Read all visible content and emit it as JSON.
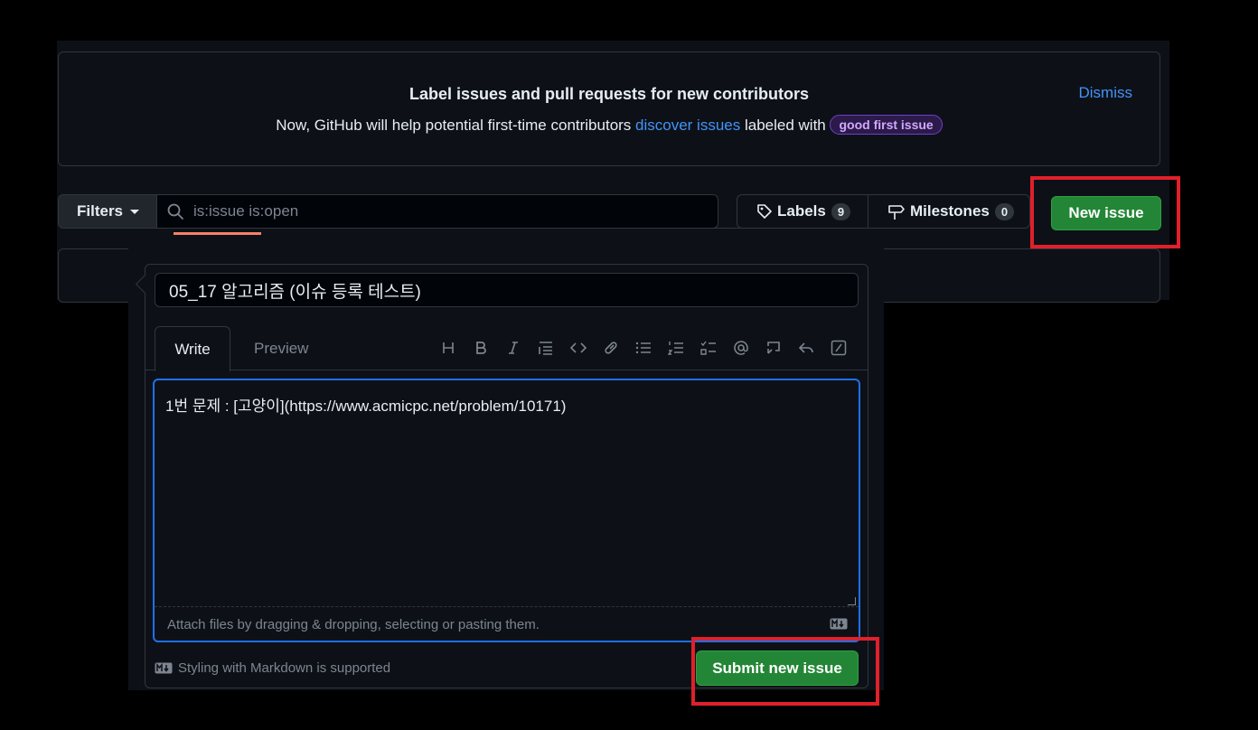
{
  "banner": {
    "title": "Label issues and pull requests for new contributors",
    "text_before": "Now, GitHub will help potential first-time contributors ",
    "link_text": "discover issues",
    "text_after": " labeled with ",
    "label": "good first issue",
    "dismiss": "Dismiss"
  },
  "toolbar": {
    "filters_label": "Filters",
    "search_value": "is:issue is:open",
    "labels_label": "Labels",
    "labels_count": "9",
    "milestones_label": "Milestones",
    "milestones_count": "0",
    "new_issue_label": "New issue"
  },
  "form": {
    "title_value": "05_17 알고리즘 (이슈 등록 테스트)",
    "tab_write": "Write",
    "tab_preview": "Preview",
    "body_value": "1번 문제 : [고양이](https://www.acmicpc.net/problem/10171)",
    "attach_hint": "Attach files by dragging & dropping, selecting or pasting them.",
    "markdown_note": "Styling with Markdown is supported",
    "submit_label": "Submit new issue",
    "editor_tools": [
      "heading-icon",
      "bold-icon",
      "italic-icon",
      "quote-icon",
      "code-icon",
      "link-icon",
      "unordered-list-icon",
      "ordered-list-icon",
      "task-list-icon",
      "mention-icon",
      "reference-icon",
      "reply-icon",
      "slash-icon"
    ]
  },
  "colors": {
    "accent_blue": "#4493f8",
    "button_green": "#238636",
    "highlight_red": "#e0202a",
    "background": "#0d1117"
  }
}
